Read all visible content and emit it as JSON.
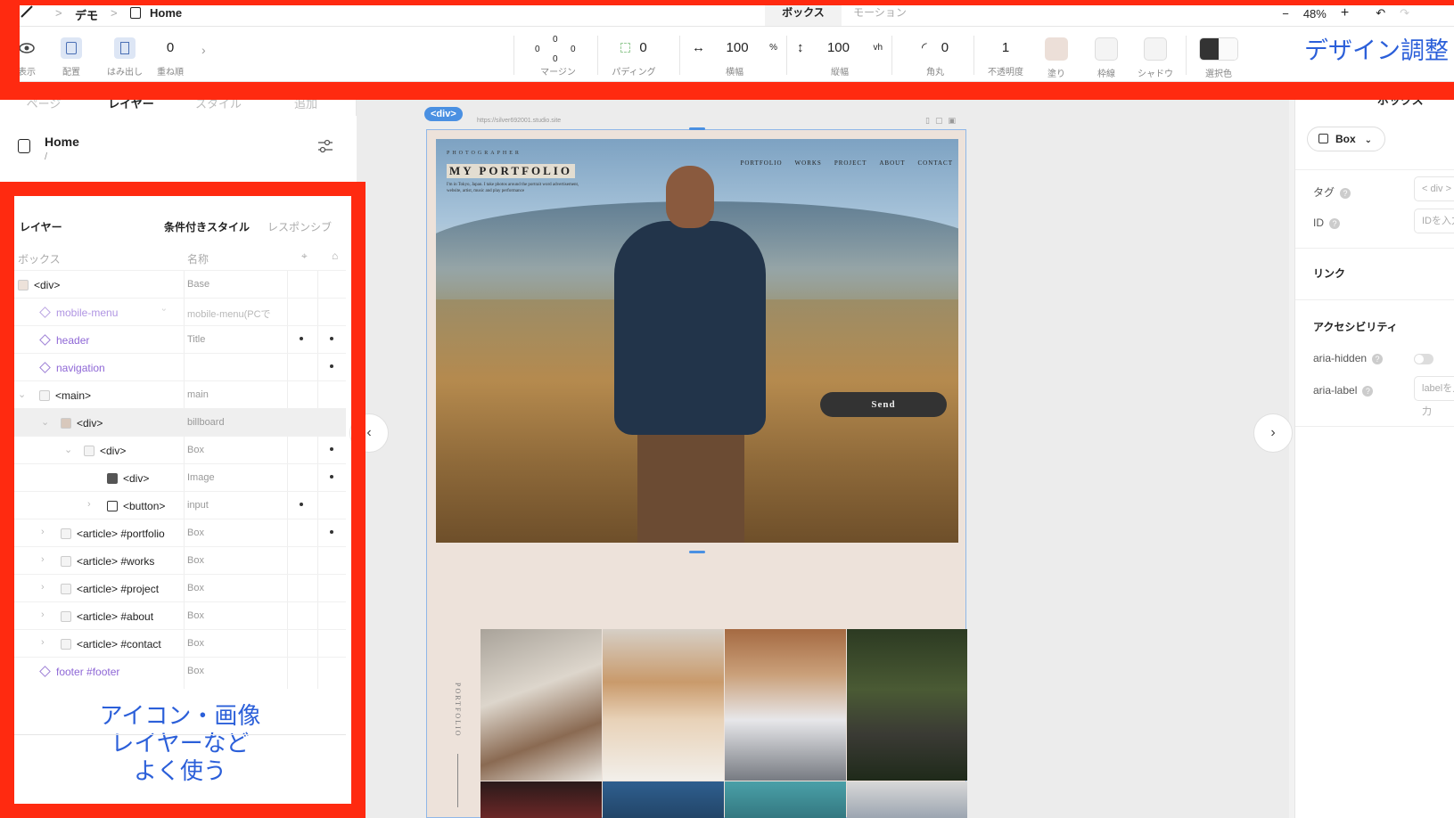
{
  "breadcrumb": {
    "project": "デモ",
    "page": "Home",
    "sep": ">"
  },
  "top_tabs": [
    {
      "label": "ボックス",
      "active": true
    },
    {
      "label": "モーション",
      "active": false
    }
  ],
  "zoom": {
    "minus": "−",
    "value": "48%",
    "plus": "+",
    "undo": "↶",
    "redo": "↷"
  },
  "toolbar": {
    "visibility": "表示",
    "placement": "配置",
    "overflow": "はみ出し",
    "zorder_value": "0",
    "zorder": "重ね順",
    "margin": {
      "top": "0",
      "left": "0",
      "right": "0",
      "bottom": "0",
      "label": "マージン"
    },
    "padding": {
      "value": "0",
      "label": "パディング"
    },
    "width": {
      "value": "100",
      "unit": "%",
      "label": "横幅"
    },
    "height": {
      "value": "100",
      "unit": "vh",
      "label": "縦幅"
    },
    "radius": {
      "value": "0",
      "label": "角丸"
    },
    "opacity": {
      "value": "1",
      "label": "不透明度"
    },
    "fill": "塗り",
    "border": "枠線",
    "shadow": "シャドウ",
    "selection_color": "選択色",
    "fill_color": "#ecdfd8"
  },
  "annotation_design": "デザイン調整",
  "annotation_layers": [
    "アイコン・画像",
    "レイヤーなど",
    "よく使う"
  ],
  "left_tabs": [
    "ページ",
    "レイヤー",
    "スタイル",
    "追加"
  ],
  "page": {
    "title": "Home",
    "path": "/"
  },
  "layers_panel": {
    "title": "レイヤー",
    "conditional": "条件付きスタイル",
    "responsive": "レスポンシブ",
    "col_box": "ボックス",
    "col_name": "名称",
    "rows": [
      {
        "label": "<div>",
        "class": "Base"
      },
      {
        "label": "mobile-menu",
        "class": "mobile-menu(PCで"
      },
      {
        "label": "header",
        "class": "Title"
      },
      {
        "label": "navigation",
        "class": ""
      },
      {
        "label": "<main>",
        "class": "main"
      },
      {
        "label": "<div>",
        "class": "billboard"
      },
      {
        "label": "<div>",
        "class": "Box"
      },
      {
        "label": "<div>",
        "class": "Image"
      },
      {
        "label": "<button>",
        "class": "input"
      },
      {
        "label": "<article> #portfolio",
        "class": "Box"
      },
      {
        "label": "<article> #works",
        "class": "Box"
      },
      {
        "label": "<article> #project",
        "class": "Box"
      },
      {
        "label": "<article> #about",
        "class": "Box"
      },
      {
        "label": "<article> #contact",
        "class": "Box"
      },
      {
        "label": "footer #footer",
        "class": "Box"
      }
    ]
  },
  "canvas": {
    "frame_label": "<div>",
    "url": "https://silver692001.studio.site",
    "hero": {
      "sub": "PHOTOGRAPHER",
      "title": "MY PORTFOLIO",
      "desc": "I'm in Tokyo, Japan. I take photos around the portrait word advertisement, website, artist, music and play performance",
      "nav": [
        "PORTFOLIO",
        "WORKS",
        "PROJECT",
        "ABOUT",
        "CONTACT"
      ],
      "button": "Send"
    },
    "side_label": "PORTFOLIO",
    "prev": "‹",
    "next": "›"
  },
  "right_panel": {
    "header": "ボックス",
    "box_type": "Box",
    "tag_label": "タグ",
    "tag_value": "< div >",
    "id_label": "ID",
    "id_placeholder": "IDを入力",
    "link": "リンク",
    "accessibility": "アクセシビリティ",
    "aria_hidden": "aria-hidden",
    "aria_label": "aria-label",
    "aria_label_placeholder": "labelを入力"
  },
  "colors": {
    "annotation_red": "#ff2a10",
    "annotation_blue": "#2b5fd9",
    "selection_blue": "#4a90e2",
    "site_bg": "#ede2da"
  }
}
